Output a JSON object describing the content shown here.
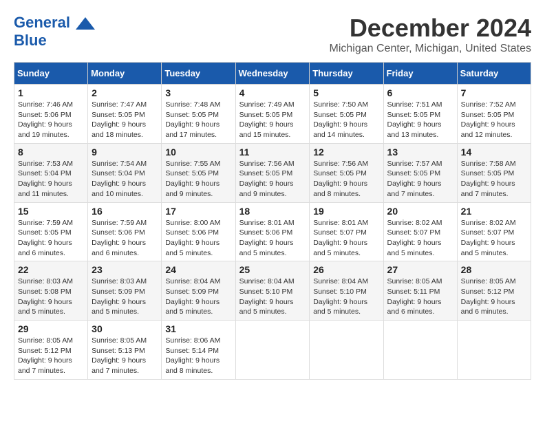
{
  "header": {
    "logo_line1": "General",
    "logo_line2": "Blue",
    "title": "December 2024",
    "subtitle": "Michigan Center, Michigan, United States"
  },
  "columns": [
    "Sunday",
    "Monday",
    "Tuesday",
    "Wednesday",
    "Thursday",
    "Friday",
    "Saturday"
  ],
  "weeks": [
    [
      {
        "day": "1",
        "sunrise": "Sunrise: 7:46 AM",
        "sunset": "Sunset: 5:06 PM",
        "daylight": "Daylight: 9 hours and 19 minutes."
      },
      {
        "day": "2",
        "sunrise": "Sunrise: 7:47 AM",
        "sunset": "Sunset: 5:05 PM",
        "daylight": "Daylight: 9 hours and 18 minutes."
      },
      {
        "day": "3",
        "sunrise": "Sunrise: 7:48 AM",
        "sunset": "Sunset: 5:05 PM",
        "daylight": "Daylight: 9 hours and 17 minutes."
      },
      {
        "day": "4",
        "sunrise": "Sunrise: 7:49 AM",
        "sunset": "Sunset: 5:05 PM",
        "daylight": "Daylight: 9 hours and 15 minutes."
      },
      {
        "day": "5",
        "sunrise": "Sunrise: 7:50 AM",
        "sunset": "Sunset: 5:05 PM",
        "daylight": "Daylight: 9 hours and 14 minutes."
      },
      {
        "day": "6",
        "sunrise": "Sunrise: 7:51 AM",
        "sunset": "Sunset: 5:05 PM",
        "daylight": "Daylight: 9 hours and 13 minutes."
      },
      {
        "day": "7",
        "sunrise": "Sunrise: 7:52 AM",
        "sunset": "Sunset: 5:05 PM",
        "daylight": "Daylight: 9 hours and 12 minutes."
      }
    ],
    [
      {
        "day": "8",
        "sunrise": "Sunrise: 7:53 AM",
        "sunset": "Sunset: 5:04 PM",
        "daylight": "Daylight: 9 hours and 11 minutes."
      },
      {
        "day": "9",
        "sunrise": "Sunrise: 7:54 AM",
        "sunset": "Sunset: 5:04 PM",
        "daylight": "Daylight: 9 hours and 10 minutes."
      },
      {
        "day": "10",
        "sunrise": "Sunrise: 7:55 AM",
        "sunset": "Sunset: 5:05 PM",
        "daylight": "Daylight: 9 hours and 9 minutes."
      },
      {
        "day": "11",
        "sunrise": "Sunrise: 7:56 AM",
        "sunset": "Sunset: 5:05 PM",
        "daylight": "Daylight: 9 hours and 9 minutes."
      },
      {
        "day": "12",
        "sunrise": "Sunrise: 7:56 AM",
        "sunset": "Sunset: 5:05 PM",
        "daylight": "Daylight: 9 hours and 8 minutes."
      },
      {
        "day": "13",
        "sunrise": "Sunrise: 7:57 AM",
        "sunset": "Sunset: 5:05 PM",
        "daylight": "Daylight: 9 hours and 7 minutes."
      },
      {
        "day": "14",
        "sunrise": "Sunrise: 7:58 AM",
        "sunset": "Sunset: 5:05 PM",
        "daylight": "Daylight: 9 hours and 7 minutes."
      }
    ],
    [
      {
        "day": "15",
        "sunrise": "Sunrise: 7:59 AM",
        "sunset": "Sunset: 5:05 PM",
        "daylight": "Daylight: 9 hours and 6 minutes."
      },
      {
        "day": "16",
        "sunrise": "Sunrise: 7:59 AM",
        "sunset": "Sunset: 5:06 PM",
        "daylight": "Daylight: 9 hours and 6 minutes."
      },
      {
        "day": "17",
        "sunrise": "Sunrise: 8:00 AM",
        "sunset": "Sunset: 5:06 PM",
        "daylight": "Daylight: 9 hours and 5 minutes."
      },
      {
        "day": "18",
        "sunrise": "Sunrise: 8:01 AM",
        "sunset": "Sunset: 5:06 PM",
        "daylight": "Daylight: 9 hours and 5 minutes."
      },
      {
        "day": "19",
        "sunrise": "Sunrise: 8:01 AM",
        "sunset": "Sunset: 5:07 PM",
        "daylight": "Daylight: 9 hours and 5 minutes."
      },
      {
        "day": "20",
        "sunrise": "Sunrise: 8:02 AM",
        "sunset": "Sunset: 5:07 PM",
        "daylight": "Daylight: 9 hours and 5 minutes."
      },
      {
        "day": "21",
        "sunrise": "Sunrise: 8:02 AM",
        "sunset": "Sunset: 5:07 PM",
        "daylight": "Daylight: 9 hours and 5 minutes."
      }
    ],
    [
      {
        "day": "22",
        "sunrise": "Sunrise: 8:03 AM",
        "sunset": "Sunset: 5:08 PM",
        "daylight": "Daylight: 9 hours and 5 minutes."
      },
      {
        "day": "23",
        "sunrise": "Sunrise: 8:03 AM",
        "sunset": "Sunset: 5:09 PM",
        "daylight": "Daylight: 9 hours and 5 minutes."
      },
      {
        "day": "24",
        "sunrise": "Sunrise: 8:04 AM",
        "sunset": "Sunset: 5:09 PM",
        "daylight": "Daylight: 9 hours and 5 minutes."
      },
      {
        "day": "25",
        "sunrise": "Sunrise: 8:04 AM",
        "sunset": "Sunset: 5:10 PM",
        "daylight": "Daylight: 9 hours and 5 minutes."
      },
      {
        "day": "26",
        "sunrise": "Sunrise: 8:04 AM",
        "sunset": "Sunset: 5:10 PM",
        "daylight": "Daylight: 9 hours and 5 minutes."
      },
      {
        "day": "27",
        "sunrise": "Sunrise: 8:05 AM",
        "sunset": "Sunset: 5:11 PM",
        "daylight": "Daylight: 9 hours and 6 minutes."
      },
      {
        "day": "28",
        "sunrise": "Sunrise: 8:05 AM",
        "sunset": "Sunset: 5:12 PM",
        "daylight": "Daylight: 9 hours and 6 minutes."
      }
    ],
    [
      {
        "day": "29",
        "sunrise": "Sunrise: 8:05 AM",
        "sunset": "Sunset: 5:12 PM",
        "daylight": "Daylight: 9 hours and 7 minutes."
      },
      {
        "day": "30",
        "sunrise": "Sunrise: 8:05 AM",
        "sunset": "Sunset: 5:13 PM",
        "daylight": "Daylight: 9 hours and 7 minutes."
      },
      {
        "day": "31",
        "sunrise": "Sunrise: 8:06 AM",
        "sunset": "Sunset: 5:14 PM",
        "daylight": "Daylight: 9 hours and 8 minutes."
      },
      null,
      null,
      null,
      null
    ]
  ]
}
